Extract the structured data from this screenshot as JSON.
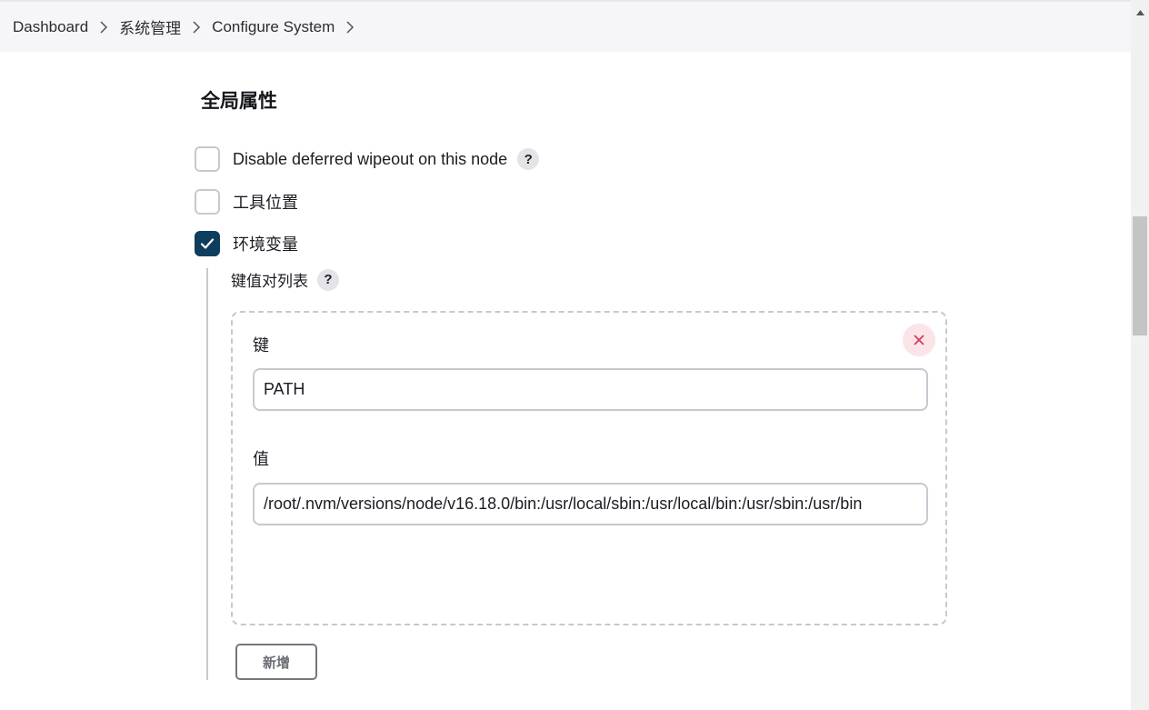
{
  "breadcrumb": {
    "items": [
      "Dashboard",
      "系统管理",
      "Configure System"
    ]
  },
  "section": {
    "title": "全局属性"
  },
  "options": [
    {
      "label": "Disable deferred wipeout on this node",
      "checked": false,
      "help": "?"
    },
    {
      "label": "工具位置",
      "checked": false
    },
    {
      "label": "环境变量",
      "checked": true
    }
  ],
  "env_vars": {
    "list_label": "键值对列表",
    "help": "?",
    "entries": [
      {
        "key_label": "键",
        "key_value": "PATH",
        "value_label": "值",
        "value_value": "/root/.nvm/versions/node/v16.18.0/bin:/usr/local/sbin:/usr/local/bin:/usr/sbin:/usr/bin"
      }
    ],
    "add_button": "新增"
  },
  "colors": {
    "checkbox_checked": "#0f3d5e",
    "delete_bg": "#fbe4e8",
    "delete_icon": "#d63c5a"
  }
}
